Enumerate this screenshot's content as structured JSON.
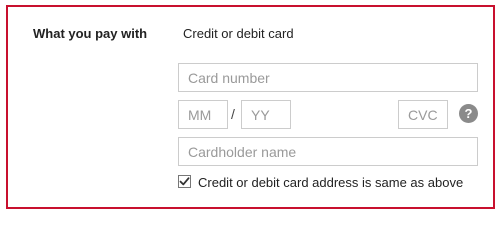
{
  "payment": {
    "section_label": "What you pay with",
    "method_label": "Credit or debit card",
    "card_number": {
      "placeholder": "Card number",
      "value": ""
    },
    "expiry": {
      "month_placeholder": "MM",
      "separator": "/",
      "year_placeholder": "YY"
    },
    "cvc": {
      "placeholder": "CVC",
      "help_glyph": "?",
      "help_icon": "question-mark-circle-icon"
    },
    "cardholder": {
      "placeholder": "Cardholder name",
      "value": ""
    },
    "same_address": {
      "checked": true,
      "label": "Credit or debit card address is same as above"
    }
  },
  "colors": {
    "frame_border": "#c8102e",
    "input_border": "#cccccc",
    "placeholder_text": "#9a9a9a",
    "help_icon_bg": "#8a8a8a"
  }
}
